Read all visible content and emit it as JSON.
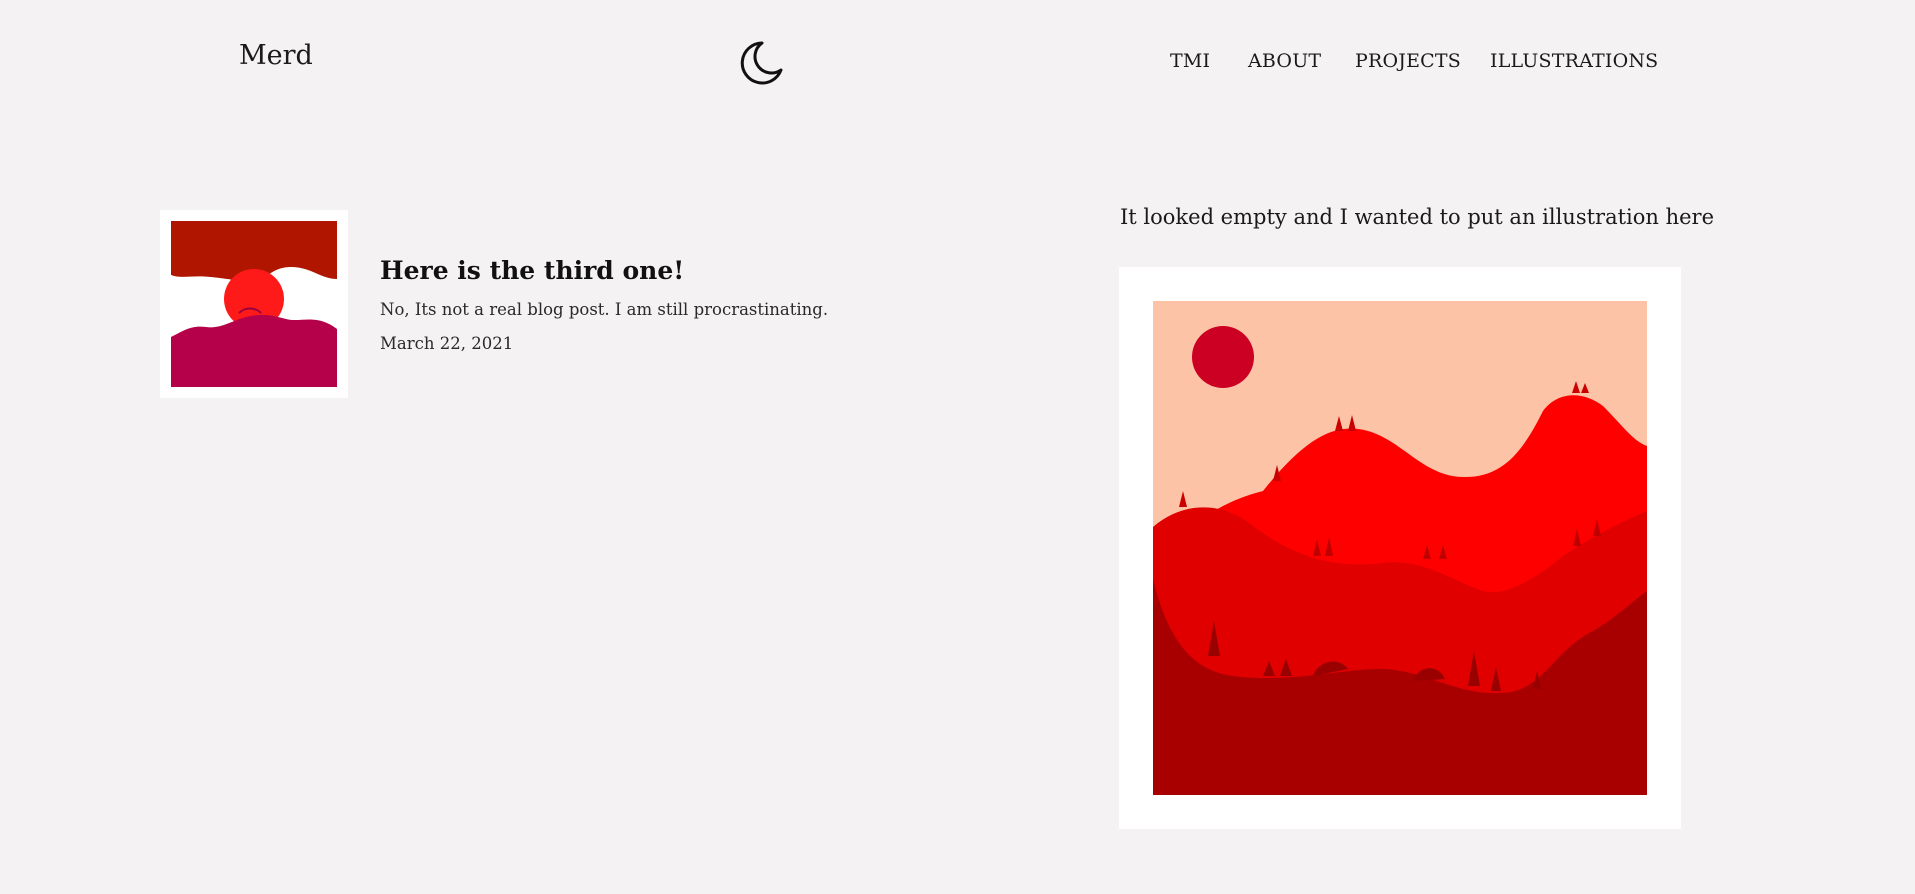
{
  "header": {
    "logo": "Merd",
    "theme_toggle_icon": "moon-icon",
    "nav": [
      "TMI",
      "ABOUT",
      "PROJECTS",
      "ILLUSTRATIONS"
    ]
  },
  "post": {
    "title": "Here is the third one!",
    "description": "No, Its not a real blog post. I am still procrastinating.",
    "date": "March 22, 2021"
  },
  "aside": {
    "caption": "It looked empty and I wanted to put an illustration here"
  },
  "colors": {
    "background": "#f4f2f3",
    "sky": "#fdc3a6",
    "sun": "#cc0022",
    "hill_bright": "#ff0000",
    "hill_mid": "#e00000",
    "hill_dark": "#a80000",
    "thumb_top": "#b01500",
    "thumb_bottom": "#b5004a"
  }
}
